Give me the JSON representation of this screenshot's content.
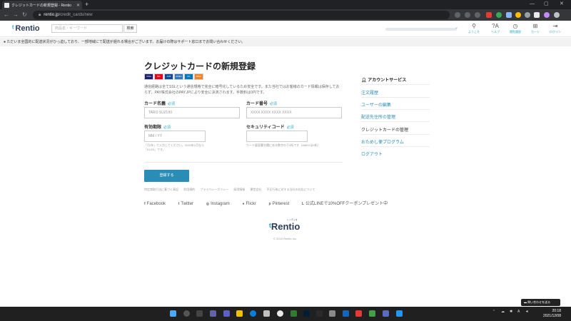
{
  "browser": {
    "tab_title": "クレジットカードの新規登録 - Rentio",
    "url_host": "rentio.jp",
    "url_path": "/credit_cards/new"
  },
  "header": {
    "logo": "Rentio",
    "search_placeholder": "商品名・キーワード",
    "search_button": "検索",
    "nav": [
      {
        "label": "ようこそ",
        "icon": "person-icon"
      },
      {
        "label": "ヘルプ",
        "icon": "help-icon"
      },
      {
        "label": "閲覧履歴",
        "icon": "history-icon"
      },
      {
        "label": "カート",
        "icon": "cart-icon"
      },
      {
        "label": "ログイン",
        "icon": "login-icon"
      }
    ]
  },
  "notice": "ただいま全国的に配送状況がひっ迫しており、一部地域にて配送が遅れる場合がございます。お届けの際はサポート窓口までお問い合わせください。",
  "form": {
    "title": "クレジットカードの新規登録",
    "card_brands": [
      "VISA",
      "MC",
      "JCB",
      "AMEX",
      "DC",
      "DISC"
    ],
    "description": "通信経路は全てSSLという通信規格で完全に暗号化しているため安全です。また当社ではお客様のカード情報は保存しておらず、PAY株式会社のPAY.JPにより安全に決済されます。手数料は0円です。",
    "required": "必須",
    "name_label": "カード名義",
    "name_placeholder": "TARO SUZUKI",
    "number_label": "カード番号",
    "number_placeholder": "XXXX XXXX XXXX XXXX",
    "expiry_label": "有効期限",
    "expiry_placeholder": "MM / YY",
    "expiry_hint_1": "「月/年」で入力してください。2020年1月なら「01/20」です。",
    "cvc_label": "セキュリティコード",
    "cvc_hint": "カード裏面署名欄にある数字の下3桁です（AMEXは4桁）",
    "submit": "登録する"
  },
  "footer_links": [
    "特定商取引法に基づく表記",
    "利用規約",
    "プライバシーポリシー",
    "採用情報",
    "運営会社",
    "不正行為に対する当社の対応について"
  ],
  "social": [
    {
      "icon": "facebook-icon",
      "glyph": "f",
      "label": "Facebook"
    },
    {
      "icon": "twitter-icon",
      "glyph": "t",
      "label": "Twitter"
    },
    {
      "icon": "instagram-icon",
      "glyph": "◎",
      "label": "Instagram"
    },
    {
      "icon": "flickr-icon",
      "glyph": "●",
      "label": "Flickr"
    },
    {
      "icon": "pinterest-icon",
      "glyph": "p",
      "label": "Pinterest"
    },
    {
      "icon": "line-icon",
      "glyph": "L",
      "label": "公式LINEで10%OFFクーポンプレゼント中"
    }
  ],
  "footer_logo": "Rentio",
  "footer_logo_ruby": "レンティオ",
  "copyright": "© 2015 Rentio Inc.",
  "sidebar": {
    "heading": "アカウントサービス",
    "items": [
      "注文履歴",
      "ユーザーの編集",
      "配送先住所の管理",
      "クレジットカードの管理",
      "おためし便プログラム",
      "ログアウト"
    ]
  },
  "chat_button": "問い合わせを送る",
  "taskbar": {
    "time": "20:18",
    "date": "2021/12/08",
    "lang": "A"
  },
  "colors": {
    "accent": "#2a8db6",
    "link": "#2aa7c5",
    "brand_dark": "#2b3d5a"
  }
}
